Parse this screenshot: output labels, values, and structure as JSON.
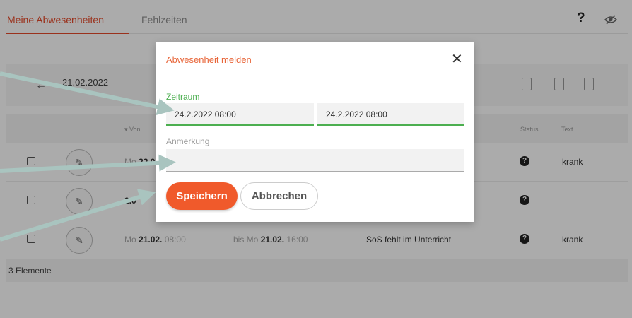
{
  "tabs": {
    "active": "Meine Abwesenheiten",
    "inactive": "Fehlzeiten"
  },
  "header": {
    "help_symbol": "?"
  },
  "toolbar": {
    "back_symbol": "←",
    "date": "21.02.2022"
  },
  "table": {
    "columns": {
      "von": "▾ Von",
      "status": "Status",
      "text": "Text"
    },
    "rows": [
      {
        "from_day": "Mo",
        "from_date": "22.0",
        "from_time": "",
        "to_prefix": "",
        "to_date": "",
        "to_time": "",
        "note": "",
        "text": "krank"
      },
      {
        "from_day": "",
        "from_date": "2.0",
        "from_time": "",
        "to_prefix": "",
        "to_date": "",
        "to_time": "",
        "note": "",
        "text": ""
      },
      {
        "from_day": "Mo",
        "from_date": "21.02.",
        "from_time": "08:00",
        "to_prefix": "bis Mo",
        "to_date": "21.02.",
        "to_time": "16:00",
        "note": "SoS fehlt im Unterricht",
        "text": "krank"
      }
    ],
    "status_symbol": "?",
    "footer": "3 Elemente"
  },
  "modal": {
    "title": "Abwesenheit melden",
    "close_symbol": "✕",
    "period_label": "Zeitraum",
    "from_value": "24.2.2022 08:00",
    "to_value": "24.2.2022 08:00",
    "note_label": "Anmerkung",
    "note_value": "",
    "save_label": "Speichern",
    "cancel_label": "Abbrechen"
  },
  "colors": {
    "accent": "#e64a2a",
    "save_button": "#f05a2b",
    "focus_green": "#4caf50",
    "arrow": "#a9c4bf"
  }
}
